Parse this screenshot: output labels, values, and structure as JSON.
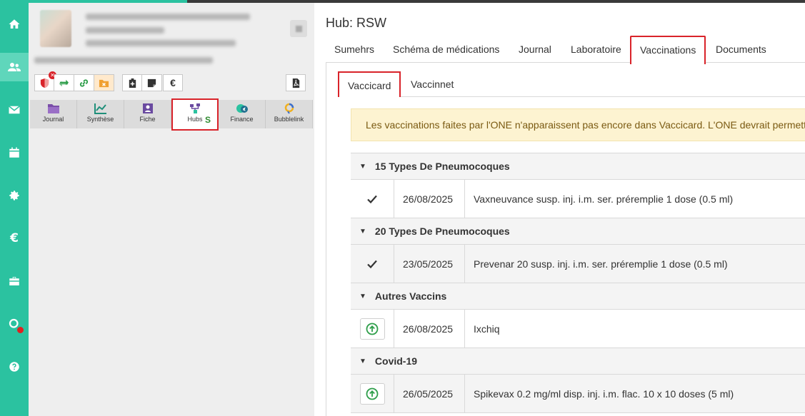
{
  "hub": {
    "title": "Hub: RSW",
    "tabs": [
      "Sumehrs",
      "Schéma de médications",
      "Journal",
      "Laboratoire",
      "Vaccinations",
      "Documents"
    ],
    "active_tab": "Vaccinations"
  },
  "subtabs": [
    "Vaccicard",
    "Vaccinnet"
  ],
  "active_subtab": "Vaccicard",
  "warning": "Les vaccinations faites par l'ONE n'apparaissent pas encore dans Vaccicard. L'ONE devrait permettre",
  "modules": [
    {
      "label": "Journal",
      "icon": "folder-icon"
    },
    {
      "label": "Synthèse",
      "icon": "chart-icon"
    },
    {
      "label": "Fiche",
      "icon": "id-card-icon"
    },
    {
      "label": "Hubs",
      "icon": "hub-icon",
      "badge": "S"
    },
    {
      "label": "Finance",
      "icon": "finance-icon"
    },
    {
      "label": "Bubblelink",
      "icon": "bubblelink-icon"
    }
  ],
  "euro_symbol": "€",
  "groups": [
    {
      "title": "15 Types De Pneumocoques",
      "rows": [
        {
          "status": "check-icon",
          "date": "26/08/2025",
          "name": "Vaxneuvance susp. inj. i.m. ser. préremplie 1 dose (0.5 ml)"
        }
      ]
    },
    {
      "title": "20 Types De Pneumocoques",
      "rows": [
        {
          "status": "check-icon",
          "date": "23/05/2025",
          "name": "Prevenar 20 susp. inj. i.m. ser. préremplie 1 dose (0.5 ml)"
        }
      ]
    },
    {
      "title": "Autres Vaccins",
      "rows": [
        {
          "status": "upload-icon",
          "date": "26/08/2025",
          "name": "Ixchiq"
        }
      ]
    },
    {
      "title": "Covid-19",
      "rows": [
        {
          "status": "upload-icon",
          "date": "26/05/2025",
          "name": "Spikevax 0.2 mg/ml disp. inj. i.m. flac. 10 x 10 doses (5 ml)"
        }
      ]
    }
  ],
  "colors": {
    "accent": "#2bc2a0",
    "highlight": "#d9232a",
    "warning_bg": "#fdf3d1",
    "success": "#2e9e4a"
  }
}
